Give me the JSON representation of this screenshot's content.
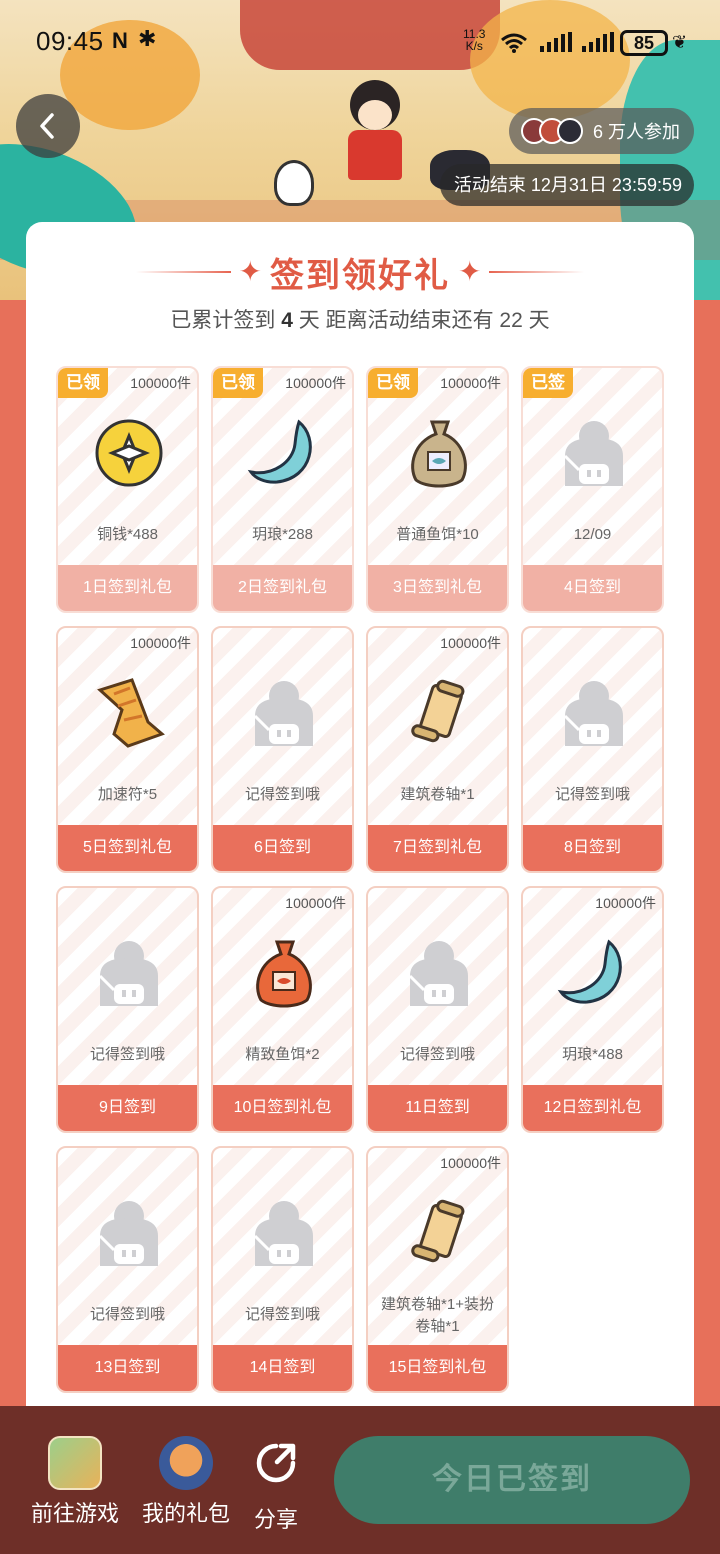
{
  "status_bar": {
    "time": "09:45",
    "nfc": "N",
    "bluetooth": "✱",
    "net_speed_value": "11.3",
    "net_speed_unit": "K/s",
    "battery": "85"
  },
  "header": {
    "participants": "6 万人参加",
    "end_time": "活动结束 12月31日 23:59:59"
  },
  "card": {
    "title": "签到领好礼",
    "subtitle_prefix": "已累计签到",
    "signed_days": "4",
    "subtitle_mid": "天  距离活动结束还有",
    "remaining_days": "22",
    "subtitle_suffix": "天"
  },
  "tiles": [
    {
      "badge": "已领",
      "count": "100000件",
      "icon": "coin-icon",
      "name": "铜钱*488",
      "footer": "1日签到礼包",
      "done": true
    },
    {
      "badge": "已领",
      "count": "100000件",
      "icon": "jade-moon-icon",
      "name": "玥琅*288",
      "footer": "2日签到礼包",
      "done": true
    },
    {
      "badge": "已领",
      "count": "100000件",
      "icon": "fish-bait-bag-icon",
      "name": "普通鱼饵*10",
      "footer": "3日签到礼包",
      "done": true
    },
    {
      "badge": "已签",
      "count": "",
      "icon": "placeholder-mascot-icon",
      "name": "12/09",
      "footer": "4日签到",
      "done": true
    },
    {
      "badge": "",
      "count": "100000件",
      "icon": "talisman-icon",
      "name": "加速符*5",
      "footer": "5日签到礼包",
      "done": false
    },
    {
      "badge": "",
      "count": "",
      "icon": "placeholder-mascot-icon",
      "name": "记得签到哦",
      "footer": "6日签到",
      "done": false
    },
    {
      "badge": "",
      "count": "100000件",
      "icon": "scroll-icon",
      "name": "建筑卷轴*1",
      "footer": "7日签到礼包",
      "done": false
    },
    {
      "badge": "",
      "count": "",
      "icon": "placeholder-mascot-icon",
      "name": "记得签到哦",
      "footer": "8日签到",
      "done": false
    },
    {
      "badge": "",
      "count": "",
      "icon": "placeholder-mascot-icon",
      "name": "记得签到哦",
      "footer": "9日签到",
      "done": false
    },
    {
      "badge": "",
      "count": "100000件",
      "icon": "fine-fish-bait-bag-icon",
      "name": "精致鱼饵*2",
      "footer": "10日签到礼包",
      "done": false
    },
    {
      "badge": "",
      "count": "",
      "icon": "placeholder-mascot-icon",
      "name": "记得签到哦",
      "footer": "11日签到",
      "done": false
    },
    {
      "badge": "",
      "count": "100000件",
      "icon": "jade-moon-icon",
      "name": "玥琅*488",
      "footer": "12日签到礼包",
      "done": false
    },
    {
      "badge": "",
      "count": "",
      "icon": "placeholder-mascot-icon",
      "name": "记得签到哦",
      "footer": "13日签到",
      "done": false
    },
    {
      "badge": "",
      "count": "",
      "icon": "placeholder-mascot-icon",
      "name": "记得签到哦",
      "footer": "14日签到",
      "done": false
    },
    {
      "badge": "",
      "count": "100000件",
      "icon": "scroll-icon",
      "name": "建筑卷轴*1+装扮卷轴*1",
      "footer": "15日签到礼包",
      "done": false
    }
  ],
  "bottom_bar": {
    "go_game": "前往游戏",
    "my_gifts": "我的礼包",
    "share": "分享",
    "signed_button": "今日已签到"
  },
  "colors": {
    "accent": "#e9705c",
    "accent_done": "#f1b1a5",
    "badge": "#f7ae2f",
    "bottom_bar": "#6e2f28",
    "signed_button": "#3f7d6a"
  }
}
